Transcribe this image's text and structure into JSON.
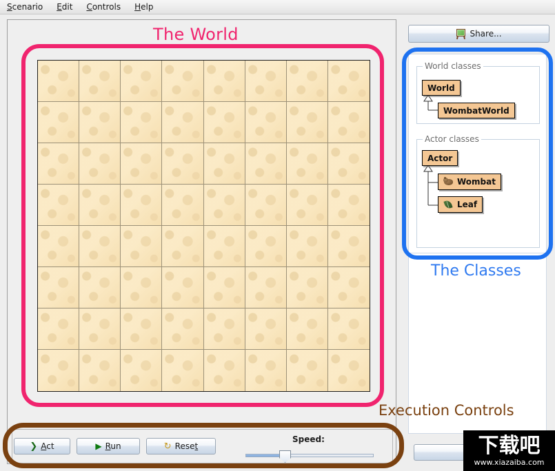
{
  "menu": {
    "items": [
      {
        "label": "Scenario",
        "mnemonic": "S"
      },
      {
        "label": "Edit",
        "mnemonic": "E"
      },
      {
        "label": "Controls",
        "mnemonic": "C"
      },
      {
        "label": "Help",
        "mnemonic": "H"
      }
    ]
  },
  "annotations": {
    "world": {
      "text": "The World",
      "color": "#f0246e"
    },
    "classes": {
      "text": "The Classes",
      "color": "#2f7af0"
    },
    "execution": {
      "text": "Execution Controls",
      "color": "#7a4110"
    }
  },
  "world": {
    "columns": 8,
    "rows": 8,
    "cell_color": "#f8e2b5",
    "grid_line_color": "#9c9178"
  },
  "share": {
    "label": "Share...",
    "icon": "easel-icon"
  },
  "class_browser": {
    "world_group": {
      "title": "World classes",
      "classes": [
        {
          "name": "World",
          "icon": null,
          "indent": 0
        },
        {
          "name": "WombatWorld",
          "icon": null,
          "indent": 1
        }
      ]
    },
    "actor_group": {
      "title": "Actor classes",
      "classes": [
        {
          "name": "Actor",
          "icon": null,
          "indent": 0
        },
        {
          "name": "Wombat",
          "icon": "wombat-icon",
          "indent": 1
        },
        {
          "name": "Leaf",
          "icon": "leaf-icon",
          "indent": 1
        }
      ]
    },
    "class_box_color": "#f4c794"
  },
  "execution_controls": {
    "act": {
      "label": "Act",
      "mnemonic": "A",
      "icon": "chevron-right-icon"
    },
    "run": {
      "label": "Run",
      "mnemonic": "R",
      "icon": "play-icon"
    },
    "reset": {
      "label": "Reset",
      "mnemonic": "t",
      "icon": "reset-icon"
    },
    "speed": {
      "label": "Speed:",
      "value": 29,
      "min": 0,
      "max": 100
    }
  },
  "watermark": {
    "text_cn": "下载吧",
    "url": "www.xiazaiba.com"
  }
}
